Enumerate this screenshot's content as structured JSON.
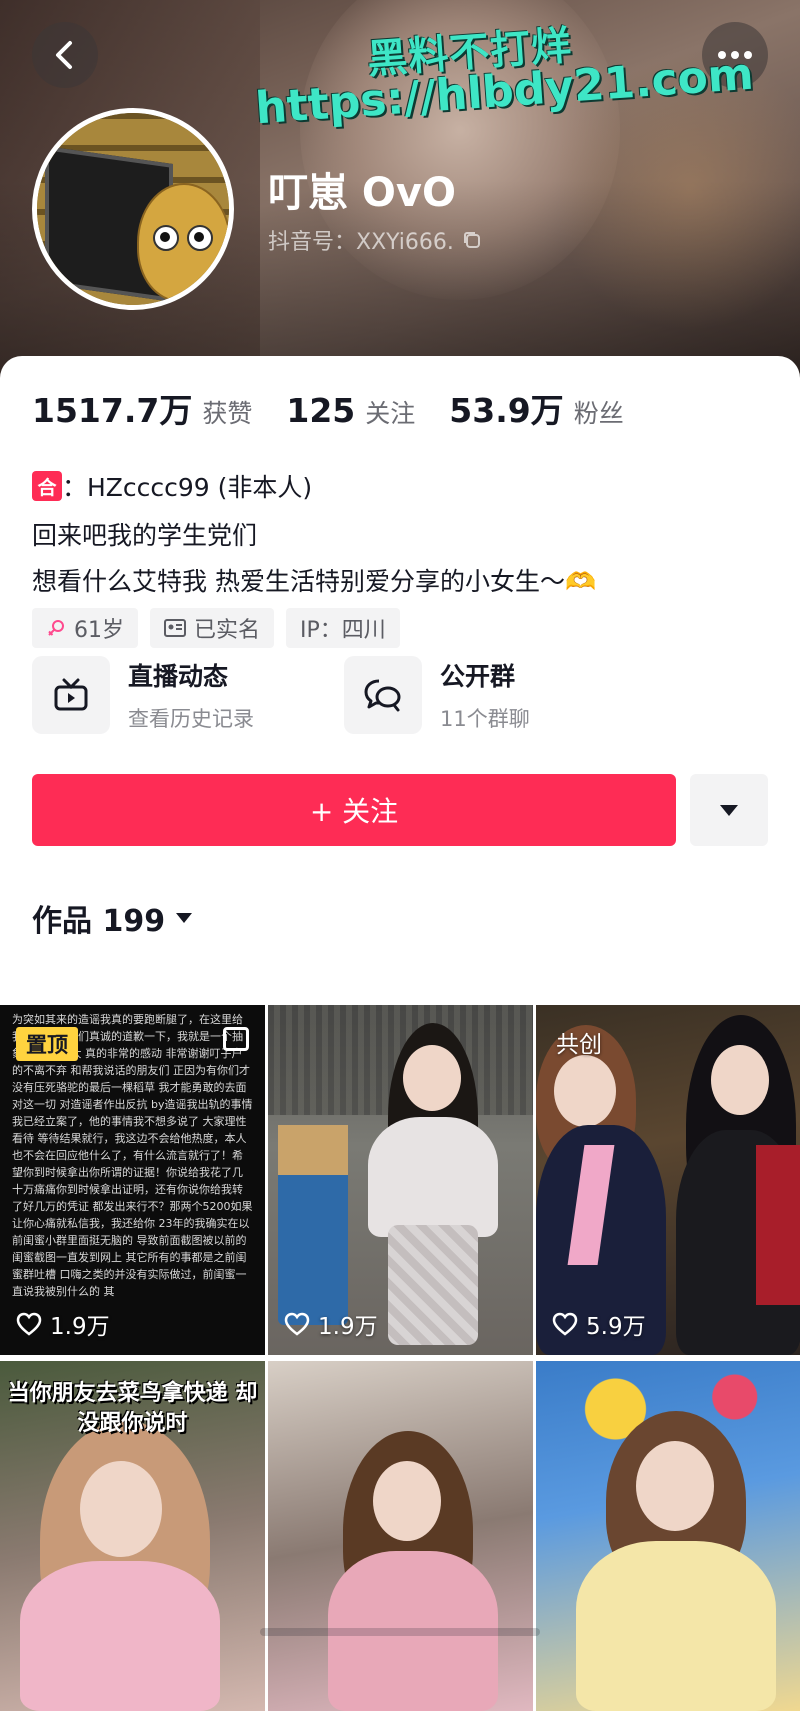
{
  "header": {
    "nickname": "叮崽 OvO",
    "douyin_id": "抖音号：XXYi666.",
    "watermark_line1": "黑料不打烊",
    "watermark_line2": "https://hlbdy21.com"
  },
  "stats": [
    {
      "value": "1517.7万",
      "label": "获赞"
    },
    {
      "value": "125",
      "label": "关注"
    },
    {
      "value": "53.9万",
      "label": "粉丝"
    }
  ],
  "collab": {
    "badge": "合",
    "text": "：HZcccc99 (非本人)"
  },
  "bio": {
    "line1": "回来吧我的学生党们",
    "line2": "想看什么艾特我 热爱生活特别爱分享的小女生～🫶"
  },
  "tags": {
    "age": "61岁",
    "verified": "已实名",
    "ip": "IP：四川"
  },
  "quick_links": [
    {
      "title": "直播动态",
      "subtitle": "查看历史记录",
      "icon": "tv-icon"
    },
    {
      "title": "公开群",
      "subtitle": "11个群聊",
      "icon": "chat-bubbles-icon"
    }
  ],
  "follow_button": "+ 关注",
  "works": {
    "label": "作品 199"
  },
  "tiles": [
    {
      "badge": "置顶",
      "likes": "1.9万",
      "text": "为突如其来的造谣我真的要跑断腿了，在这里给我的粉丝宝宝们真诚的道歉一下，我就是一个抽象博主 没有大 真的非常的感动 非常谢谢叮子户的不离不弃 和帮我说话的朋友们 正因为有你们才没有压死骆驼的最后一棵稻草 我才能勇敢的去面对这一切 对造谣者作出反抗  by造谣我出轨的事情我已经立案了，他的事情我不想多说了 大家理性看待 等待结果就行，我这边不会给他热度，本人也不会在回应他什么了，有什么流言就行了！希望你到时候拿出你所谓的证据！你说给我花了几十万痛痛你到时候拿出证明，还有你说你给我转了好几万的凭证 都发出来行不？那两个5200如果让你心痛就私信我，我还给你  23年的我确实在以前闺蜜小群里面挺无脑的 导致前面截图被以前的闺蜜截图一直发到网上 其它所有的事都是之前闺蜜群吐槽 口嗨之类的并没有实际做过，前闺蜜一直说我被别什么的 其"
    },
    {
      "likes": "1.9万"
    },
    {
      "badge": "共创",
      "likes": "5.9万"
    },
    {
      "caption": "当你朋友去菜鸟拿快递 却没跟你说时"
    },
    {},
    {}
  ],
  "colors": {
    "accent": "#fe2c55",
    "pin_badge": "#ffd33f",
    "watermark": "#3ee6c6"
  }
}
